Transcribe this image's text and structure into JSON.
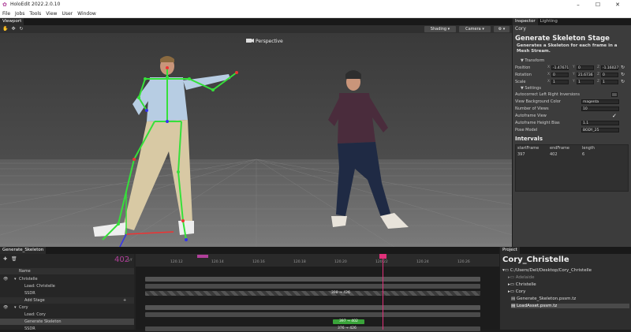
{
  "window": {
    "title": "HoloEdit 2022.2.0.10",
    "minimize": "–",
    "maximize": "☐",
    "close": "✕"
  },
  "menu": [
    "File",
    "Jobs",
    "Tools",
    "View",
    "User",
    "Window"
  ],
  "viewport": {
    "tab": "Viewport",
    "camera_label": "Perspective",
    "shading_button": "Shading ▾",
    "camera_button": "Camera ▾",
    "settings_button": "⚙ ▾"
  },
  "inspector": {
    "tabs": [
      "Inspector",
      "Lighting"
    ],
    "object_name": "Cory",
    "component_title": "Generate Skeleton Stage",
    "description": "Generates a Skeleton for each frame in a Mesh Stream.",
    "transform_header": "▼ Transform",
    "position": {
      "label": "Position",
      "x": "-1.47671",
      "y": "0",
      "z": "-1.16027"
    },
    "rotation": {
      "label": "Rotation",
      "x": "0",
      "y": "21.6736",
      "z": "0"
    },
    "scale": {
      "label": "Scale",
      "x": "1",
      "y": "1",
      "z": "1"
    },
    "settings_header": "▼ Settings",
    "settings": [
      {
        "label": "Autocorrect Left Right Inversions",
        "value": ""
      },
      {
        "label": "View Background Color",
        "value": "magenta"
      },
      {
        "label": "Number of Views",
        "value": "10"
      },
      {
        "label": "Autoframe View",
        "value": "✓"
      },
      {
        "label": "Autoframe Height Bias",
        "value": "1.1"
      },
      {
        "label": "Pose Model",
        "value": "BODY_25"
      }
    ],
    "intervals": {
      "title": "Intervals",
      "headers": [
        "startFrame",
        "endFrame",
        "length"
      ],
      "rows": [
        [
          "397",
          "402",
          "6"
        ]
      ]
    }
  },
  "timeline": {
    "tab": "Generate_Skeleton",
    "frame_display": "402",
    "fps_suffix": "s/f",
    "name_header": "Name",
    "tracks": [
      {
        "name": "Christelle",
        "indent": 0,
        "group": true
      },
      {
        "name": "Load: Christelle",
        "indent": 1
      },
      {
        "name": "SSDR",
        "indent": 1
      },
      {
        "name": "Add Stage",
        "indent": 1,
        "add": true
      },
      {
        "name": "Cory",
        "indent": 0,
        "group": true
      },
      {
        "name": "Load: Cory",
        "indent": 1
      },
      {
        "name": "Generate Skeleton",
        "indent": 1,
        "selected": true
      },
      {
        "name": "SSDR",
        "indent": 1
      }
    ],
    "ruler_labels": [
      "120.12",
      "120.14",
      "120.16",
      "120.18",
      "120.20",
      "120.22",
      "120.24",
      "120.26"
    ],
    "clip_label_1": "398 → 426",
    "clip_label_2": "397 → 402",
    "clip_label_3": "376 → 426"
  },
  "project": {
    "tab": "Project",
    "title": "Cory_Christelle",
    "path": "C:/Users/Dell/Desktop/Cory_Christelle",
    "items": [
      {
        "name": "Adelaide",
        "type": "folder",
        "dim": true
      },
      {
        "name": "Christelle",
        "type": "folder"
      },
      {
        "name": "Cory",
        "type": "folder"
      },
      {
        "name": "Generate_Skeleton.pssm.tz",
        "type": "file"
      },
      {
        "name": "LoadAsset.pssm.tz",
        "type": "file",
        "selected": true
      }
    ]
  },
  "colors": {
    "accent": "#b0409a",
    "playhead": "#e0317a",
    "skeleton": "#36e03a"
  }
}
